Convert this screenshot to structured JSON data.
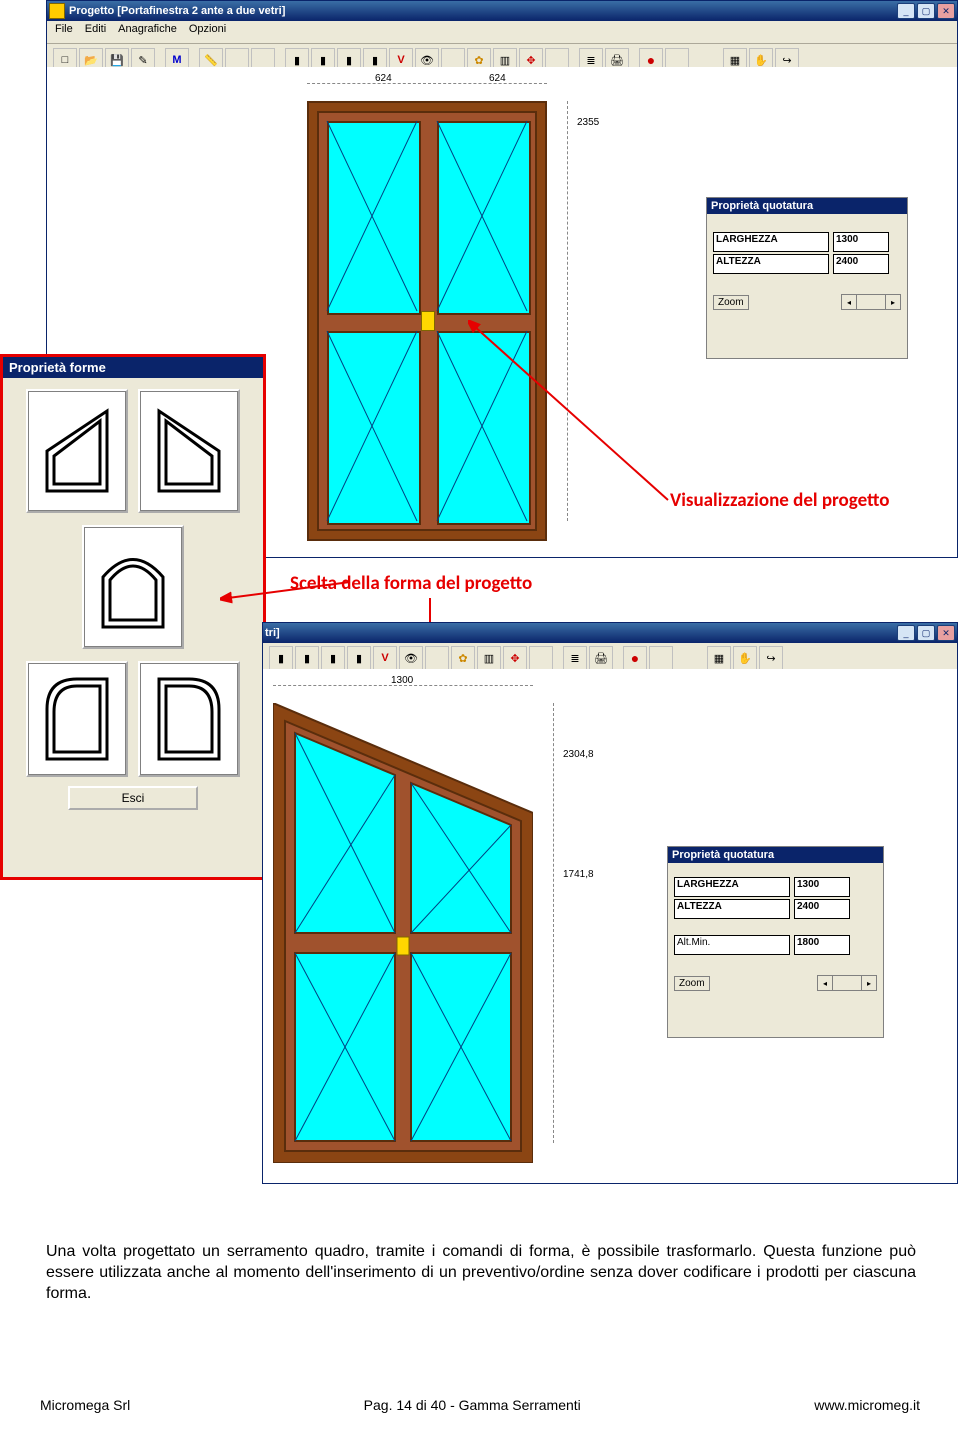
{
  "topWindow": {
    "title": "Progetto [Portafinestra 2 ante a due vetri]",
    "menus": [
      "File",
      "Editi",
      "Anagrafiche",
      "Opzioni"
    ],
    "dims": {
      "top_left": "624",
      "top_right": "624",
      "right": "2355"
    }
  },
  "quot1": {
    "title": "Proprietà quotatura",
    "rows": [
      {
        "label": "LARGHEZZA",
        "val": "1300"
      },
      {
        "label": "ALTEZZA",
        "val": "2400"
      }
    ],
    "zoom": "Zoom"
  },
  "shapes": {
    "title": "Proprietà forme",
    "esci": "Esci"
  },
  "bottomWindow": {
    "titleFragment": "tri]",
    "dims": {
      "top": "1300",
      "r1": "2304,8",
      "r2": "1741,8"
    }
  },
  "quot2": {
    "title": "Proprietà quotatura",
    "rows": [
      {
        "label": "LARGHEZZA",
        "val": "1300"
      },
      {
        "label": "ALTEZZA",
        "val": "2400"
      },
      {
        "label": "Alt.Min.",
        "val": "1800"
      }
    ],
    "zoom": "Zoom"
  },
  "annotations": {
    "viz": "Visualizzazione del progetto",
    "scelta": "Scelta della forma del progetto"
  },
  "bodyText": "Una volta progettato un serramento quadro, tramite i comandi di forma, è possibile trasformarlo. Questa funzione può essere utilizzata anche al momento dell'inserimento di un preventivo/ordine senza dover codificare i prodotti per ciascuna forma.",
  "footer": {
    "left": "Micromega Srl",
    "center": "Pag. 14 di 40 - Gamma Serramenti",
    "right": "www.micromeg.it"
  }
}
